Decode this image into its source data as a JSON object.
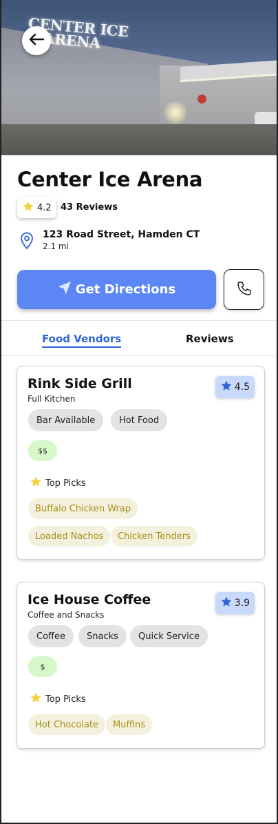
{
  "venue": {
    "name": "Center Ice Arena",
    "sign_text_line1": "CENTER ICE",
    "sign_text_line2": "ARENA",
    "rating": "4.2",
    "reviews": "43 Reviews",
    "address": "123 Road Street, Hamden CT",
    "distance": "2.1 mi"
  },
  "actions": {
    "directions_label": "Get Directions"
  },
  "tabs": [
    {
      "label": "Food Vendors",
      "active": true
    },
    {
      "label": "Reviews",
      "active": false
    }
  ],
  "vendors": [
    {
      "name": "Rink Side Grill",
      "type": "Full Kitchen",
      "rating": "4.5",
      "tags": [
        "Bar Available",
        "Hot Food"
      ],
      "price": "$$",
      "top_picks_label": "Top Picks",
      "top_picks": [
        "Buffalo Chicken Wrap",
        "Loaded Nachos",
        "Chicken Tenders"
      ]
    },
    {
      "name": "Ice House Coffee",
      "type": "Coffee and Snacks",
      "rating": "3.9",
      "tags": [
        "Coffee",
        "Snacks",
        "Quick Service"
      ],
      "price": "$",
      "top_picks_label": "Top Picks",
      "top_picks": [
        "Hot Chocolate",
        "Muffins"
      ]
    }
  ],
  "colors": {
    "accent": "#5b86f4",
    "tab_active": "#2f62d8",
    "star_yellow": "#f3d23c",
    "star_blue": "#2f62d8",
    "price_bg": "#d6f8c8",
    "pick_bg": "#f3f1dd",
    "pick_text": "#a88e1a"
  },
  "icons": {
    "back": "arrow-left-icon",
    "location": "map-pin-icon",
    "directions": "navigation-arrow-icon",
    "phone": "phone-icon",
    "star": "star-icon"
  }
}
